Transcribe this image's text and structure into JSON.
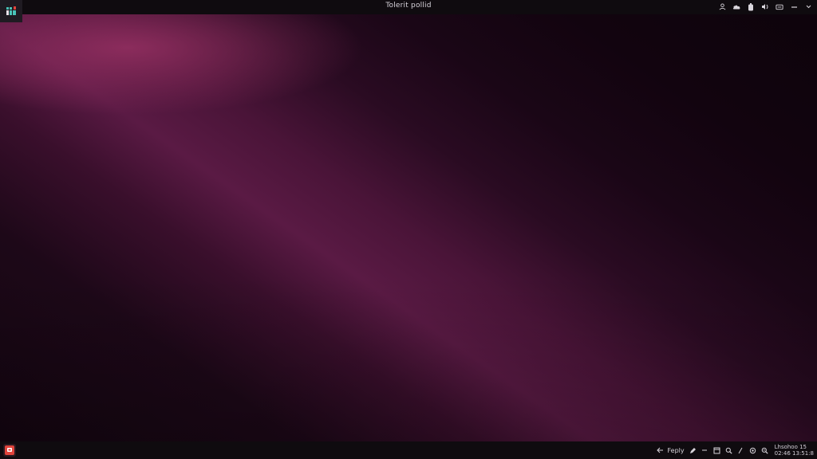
{
  "top_bar": {
    "window_title": "Tolerit pollid",
    "tray_icons": [
      "user-icon",
      "cloud-icon",
      "battery-icon",
      "volume-icon",
      "network-icon",
      "minimize-icon",
      "chevron-down-icon"
    ]
  },
  "bottom_bar": {
    "reply_label": "Feply",
    "icons": [
      "back-arrow-icon",
      "pen-icon",
      "minus-icon",
      "window-icon",
      "search-icon",
      "slash-icon",
      "settings-icon",
      "zoom-icon"
    ],
    "clock_line1": "Lhsohoo 15",
    "clock_line2": "02:46 13:51:8"
  },
  "colors": {
    "panel_bg": "#0f0b0f",
    "wallpaper_accent": "#8a2a5c",
    "wallpaper_dark": "#12040f",
    "panel_text": "#d8d4dc",
    "app_icon_red": "#e0443c",
    "activities_teal": "#49c4b8"
  }
}
